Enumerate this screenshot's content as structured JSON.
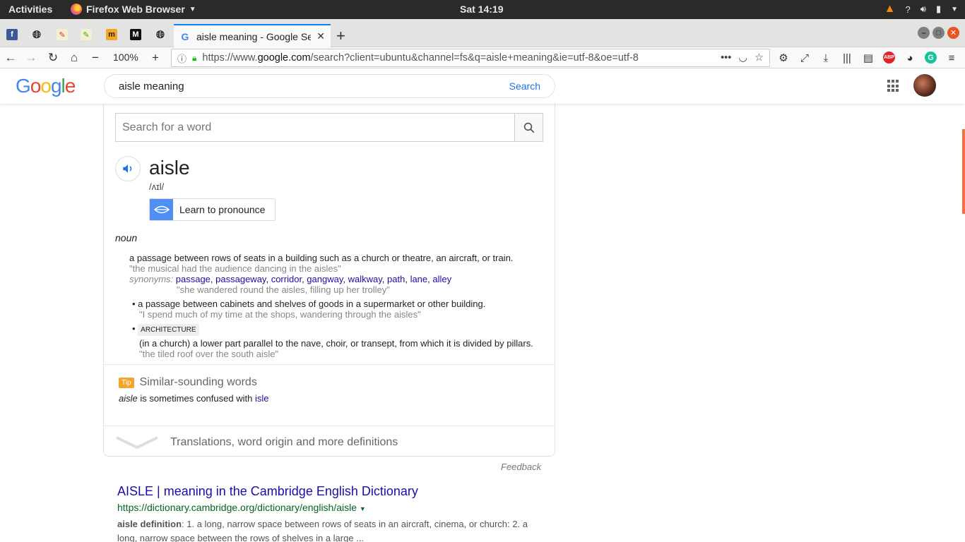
{
  "system": {
    "activities": "Activities",
    "app_name": "Firefox Web Browser",
    "clock": "Sat 14:19",
    "help": "?"
  },
  "tabs": {
    "active_title": "aisle meaning - Google Se",
    "new_tab": "+"
  },
  "nav": {
    "zoom": "100%",
    "url_prefix": "https://www.",
    "url_host": "google.com",
    "url_rest": "/search?client=ubuntu&channel=fs&q=aisle+meaning&ie=utf-8&oe=utf-8"
  },
  "google": {
    "query": "aisle meaning",
    "search_button": "Search"
  },
  "dictionary": {
    "search_placeholder": "Search for a word",
    "word": "aisle",
    "pronunciation": "/ʌɪl/",
    "learn_button": "Learn to pronounce",
    "part_of_speech": "noun",
    "def1": "a passage between rows of seats in a building such as a church or theatre, an aircraft, or train.",
    "def1_example": "\"the musical had the audience dancing in the aisles\"",
    "synonyms_label": "synonyms:",
    "synonyms": [
      "passage",
      "passageway",
      "corridor",
      "gangway",
      "walkway",
      "path",
      "lane",
      "alley"
    ],
    "syn_example": "\"she wandered round the aisles, filling up her trolley\"",
    "def2": "a passage between cabinets and shelves of goods in a supermarket or other building.",
    "def2_example": "\"I spend much of my time at the shops, wandering through the aisles\"",
    "def3_tag": "ARCHITECTURE",
    "def3": "(in a church) a lower part parallel to the nave, choir, or transept, from which it is divided by pillars.",
    "def3_example": "\"the tiled roof over the south aisle\"",
    "tip_badge": "Tip",
    "tip_title": "Similar-sounding words",
    "confused_word": "aisle",
    "confused_text": " is sometimes confused with ",
    "confused_link": "isle",
    "more_text": "Translations, word origin and more definitions"
  },
  "feedback": "Feedback",
  "result": {
    "title": "AISLE | meaning in the Cambridge English Dictionary",
    "url": "https://dictionary.cambridge.org/dictionary/english/aisle",
    "snippet_bold": "aisle definition",
    "snippet": ": 1. a long, narrow space between rows of seats in an aircraft, cinema, or church: 2. a long, narrow space between the rows of shelves in a large ..."
  }
}
